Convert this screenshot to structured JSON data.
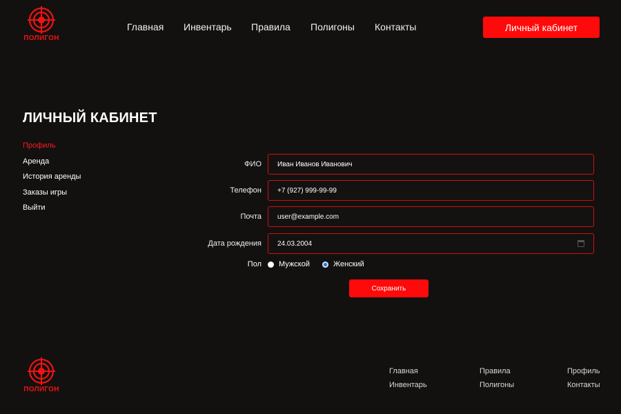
{
  "brand": {
    "name": "ПОЛИГОН",
    "color": "#f21212",
    "icon": "target-logo-icon"
  },
  "nav": {
    "items": [
      "Главная",
      "Инвентарь",
      "Правила",
      "Полигоны",
      "Контакты"
    ],
    "cabinet_button": "Личный кабинет"
  },
  "page": {
    "title": "ЛИЧНЫЙ КАБИНЕТ"
  },
  "side_menu": {
    "items": [
      "Профиль",
      "Аренда",
      "История аренды",
      "Заказы игры",
      "Выйти"
    ],
    "active": "Профиль"
  },
  "form": {
    "fio_label": "ФИО",
    "fio_value": "Иван Иванов Иванович",
    "phone_label": "Телефон",
    "phone_value": "+7 (927) 999-99-99",
    "email_label": "Почта",
    "email_value": "user@example.com",
    "birth_label": "Дата рождения",
    "birth_value": "24.03.2004",
    "gender_label": "Пол",
    "gender_options": [
      "Мужской",
      "Женский"
    ],
    "gender_selected": "Женский",
    "save_label": "Сохранить"
  },
  "footer": {
    "columns": [
      [
        "Главная",
        "Инвентарь"
      ],
      [
        "Правила",
        "Полигоны"
      ],
      [
        "Профиль",
        "Контакты"
      ]
    ]
  },
  "colors": {
    "accent": "#ff0a0a",
    "background": "#121110",
    "field_border": "#d01010"
  }
}
